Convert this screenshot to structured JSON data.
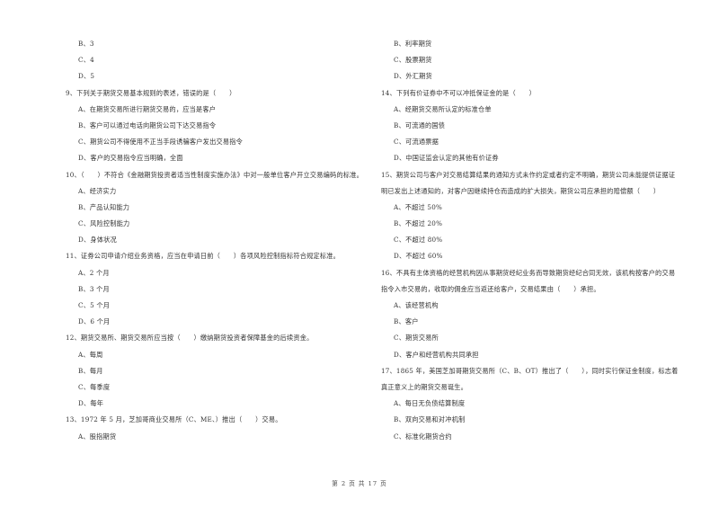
{
  "left_column": {
    "leading_options": [
      "B、3",
      "C、4",
      "D、5"
    ],
    "questions": [
      {
        "number": "9",
        "stem": "9、下列关于期货交易基本规则的表述，错误的是（　　）",
        "options": [
          "A、在期货交易所进行期货交易的，应当是客户",
          "B、客户可以通过电话向期货公司下达交易指令",
          "C、期货公司不得使用不正当手段诱骗客户发出交易指令",
          "D、客户的交易指令应当明确，全面"
        ]
      },
      {
        "number": "10",
        "stem": "10、（　　）不符合《金融期货投资者适当性制度实施办法》中对一般单位客户开立交易编码的标准。",
        "options": [
          "A、经济实力",
          "B、产品认知能力",
          "C、风险控制能力",
          "D、身体状况"
        ]
      },
      {
        "number": "11",
        "stem": "11、证券公司申请介绍业务资格，应当在申请日前（　　）各项风险控制指标符合规定标准。",
        "options": [
          "A、2 个月",
          "B、3 个月",
          "C、5 个月",
          "D、6 个月"
        ]
      },
      {
        "number": "12",
        "stem": "12、期货交易所、期货交易所应当按（　　）缴纳期货投资者保障基金的后续资金。",
        "options": [
          "A、每周",
          "B、每月",
          "C、每季度",
          "D、每年"
        ]
      },
      {
        "number": "13",
        "stem": "13、1972 年 5 月，芝加哥商业交易所（C、ME、）推出（　　）交易。",
        "options": [
          "A、股指期货"
        ]
      }
    ]
  },
  "right_column": {
    "leading_options": [
      "B、利率期货",
      "C、股票期货",
      "D、外汇期货"
    ],
    "questions": [
      {
        "number": "14",
        "stem": "14、下列有价证券中不可以冲抵保证金的是（　　）",
        "options": [
          "A、经期货交易所认定的标准仓单",
          "B、可流通的国债",
          "C、可流通票据",
          "D、中国证监会认定的其他有价证券"
        ]
      },
      {
        "number": "15",
        "stem": "15、期货公司与客户对交易结算结果的通知方式未作约定或者约定不明确，期货公司未能提供证据证明已发出上述通知的，对客户因继续持仓而造成的扩大损失，期货公司应承担的赔偿额（　　）",
        "options": [
          "A、不超过 50%",
          "B、不超过 20%",
          "C、不超过 80%",
          "D、不超过 60%"
        ]
      },
      {
        "number": "16",
        "stem": "16、不具有主体资格的经营机构因从事期货经纪业务而导致期货经纪合同无效，该机构按客户的交易指令入市交易的，收取的佣金应当返还给客户，交易结果由（　　）承担。",
        "options": [
          "A、该经营机构",
          "B、客户",
          "C、期货交易所",
          "D、客户和经营机构共同承担"
        ]
      },
      {
        "number": "17",
        "stem": "17、1865 年，美国芝加哥期货交易所（C、B、OT）推出了（　　），同时实行保证金制度，标志着真正意义上的期货交易诞生。",
        "options": [
          "A、每日无负债结算制度",
          "B、双向交易和对冲机制",
          "C、标准化期货合约"
        ]
      }
    ]
  },
  "footer": {
    "page_info": "第 2 页 共 17 页"
  }
}
